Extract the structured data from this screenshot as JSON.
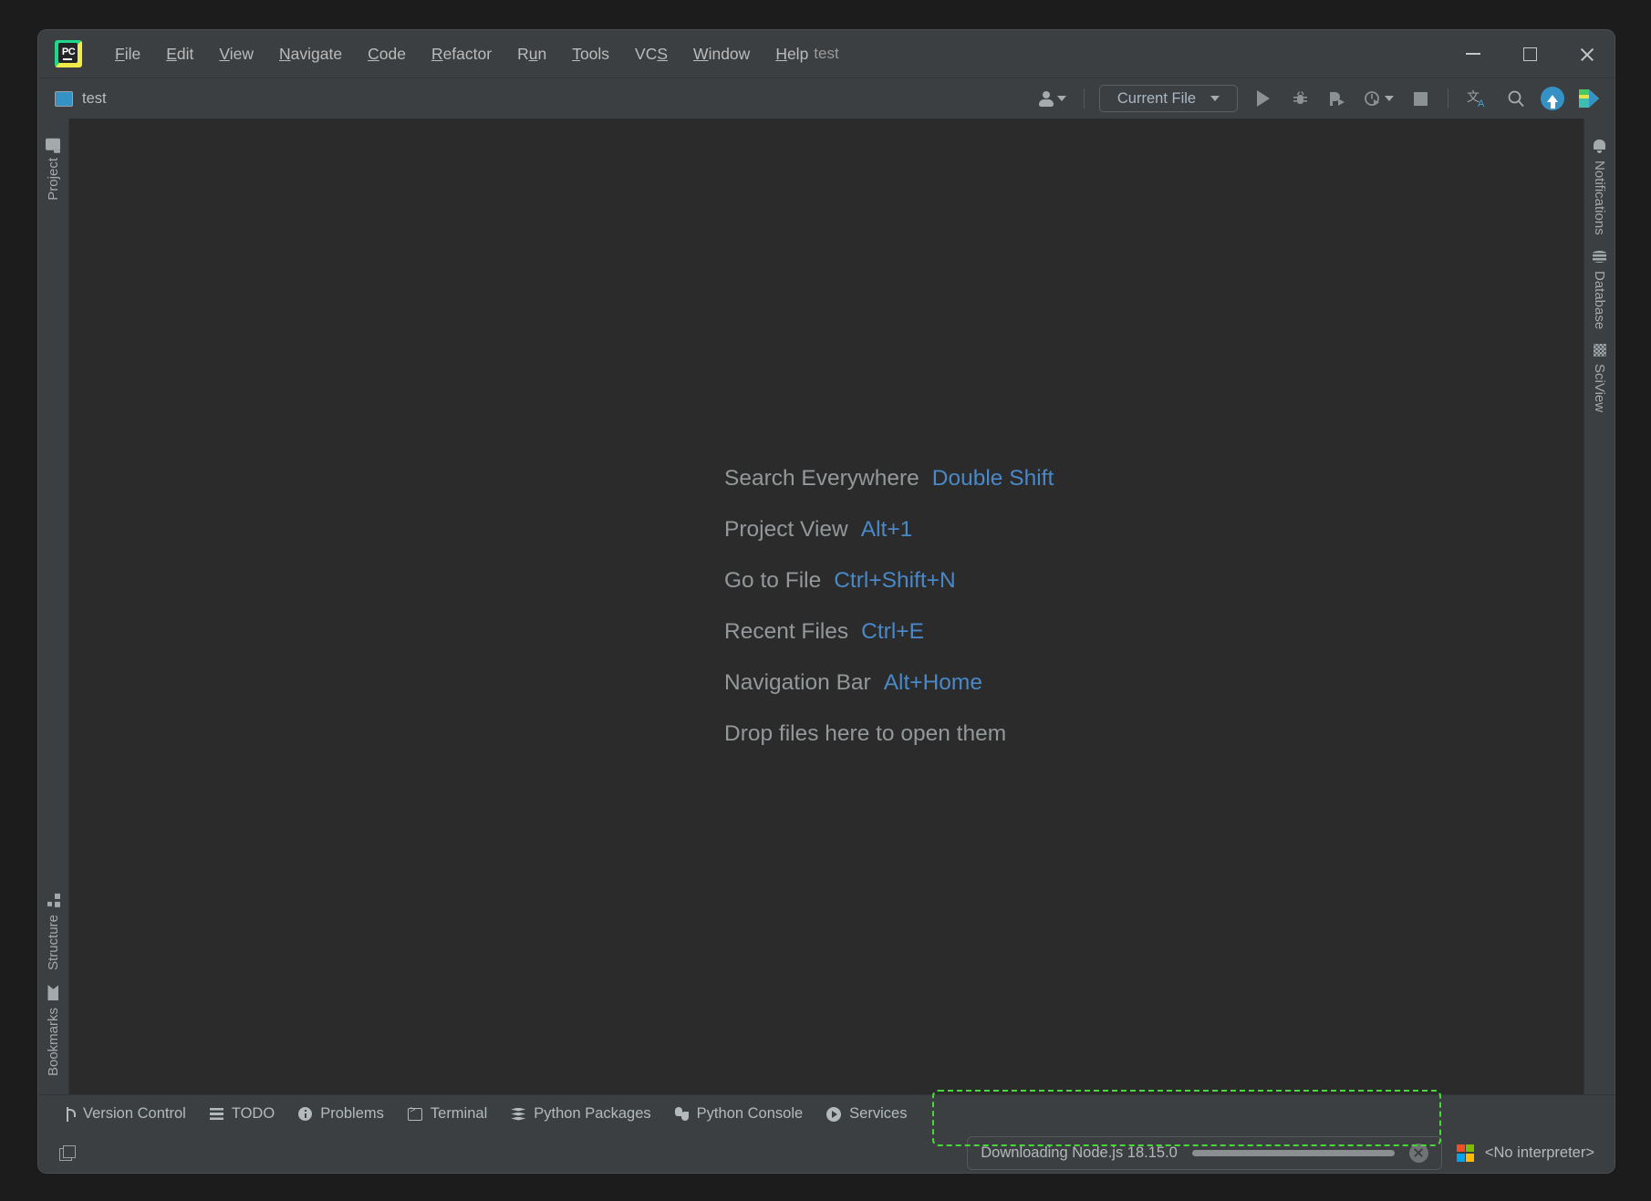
{
  "window": {
    "title": "test",
    "logo_text": "PC",
    "controls": {
      "minimize": "minimize-button",
      "maximize": "maximize-button",
      "close": "close-button"
    }
  },
  "menu_bar": {
    "items": [
      {
        "label": "File",
        "mnemonic": "F"
      },
      {
        "label": "Edit",
        "mnemonic": "E"
      },
      {
        "label": "View",
        "mnemonic": "V"
      },
      {
        "label": "Navigate",
        "mnemonic": "N"
      },
      {
        "label": "Code",
        "mnemonic": "C"
      },
      {
        "label": "Refactor",
        "mnemonic": "R"
      },
      {
        "label": "Run",
        "mnemonic": "u"
      },
      {
        "label": "Tools",
        "mnemonic": "T"
      },
      {
        "label": "VCS",
        "mnemonic": "S"
      },
      {
        "label": "Window",
        "mnemonic": "W"
      },
      {
        "label": "Help",
        "mnemonic": "H"
      }
    ]
  },
  "toolbar": {
    "project_name": "test",
    "run_configuration": "Current File",
    "icons": [
      "person-icon",
      "run-icon",
      "debug-icon",
      "run-coverage-icon",
      "profile-icon",
      "stop-icon",
      "translate-icon",
      "search-icon",
      "update-project-icon",
      "datalore-icon"
    ]
  },
  "left_sidebar": {
    "top_items": [
      {
        "label": "Project",
        "icon": "folder-icon"
      }
    ],
    "bottom_items": [
      {
        "label": "Structure",
        "icon": "structure-icon"
      },
      {
        "label": "Bookmarks",
        "icon": "bookmark-icon"
      }
    ]
  },
  "right_sidebar": {
    "items": [
      {
        "label": "Notifications",
        "icon": "bell-icon"
      },
      {
        "label": "Database",
        "icon": "database-icon"
      },
      {
        "label": "SciView",
        "icon": "grid-icon"
      }
    ]
  },
  "editor": {
    "hints": [
      {
        "label": "Search Everywhere",
        "shortcut": "Double Shift"
      },
      {
        "label": "Project View",
        "shortcut": "Alt+1"
      },
      {
        "label": "Go to File",
        "shortcut": "Ctrl+Shift+N"
      },
      {
        "label": "Recent Files",
        "shortcut": "Ctrl+E"
      },
      {
        "label": "Navigation Bar",
        "shortcut": "Alt+Home"
      }
    ],
    "drop_hint": "Drop files here to open them"
  },
  "tool_tabs": [
    {
      "label": "Version Control",
      "icon": "branch-icon"
    },
    {
      "label": "TODO",
      "icon": "list-icon"
    },
    {
      "label": "Problems",
      "icon": "info-icon"
    },
    {
      "label": "Terminal",
      "icon": "terminal-icon"
    },
    {
      "label": "Python Packages",
      "icon": "layers-icon"
    },
    {
      "label": "Python Console",
      "icon": "python-icon"
    },
    {
      "label": "Services",
      "icon": "play-circle-icon"
    }
  ],
  "status_bar": {
    "layout_icon": "windows-layout-icon",
    "progress": {
      "text": "Downloading Node.js 18.15.0",
      "cancel_icon": "cancel-icon"
    },
    "interpreter": {
      "icon": "microsoft-icon",
      "label": "<No interpreter>"
    }
  },
  "colors": {
    "accent_blue": "#4a88c7",
    "toolbar_bg": "#3c3f41",
    "editor_bg": "#2b2b2b",
    "highlight_green": "#49d83a"
  }
}
